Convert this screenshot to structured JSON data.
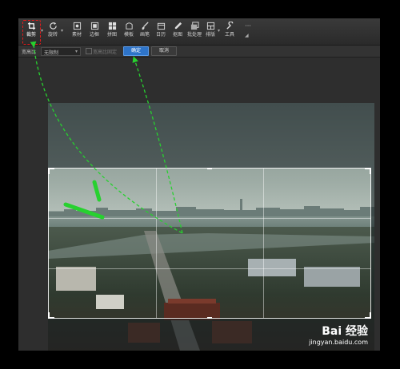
{
  "toolbar": {
    "items": [
      {
        "label": "裁剪",
        "icon": "crop-icon"
      },
      {
        "label": "旋转",
        "icon": "rotate-icon"
      },
      {
        "label": "素材",
        "icon": "material-icon"
      },
      {
        "label": "边框",
        "icon": "border-icon"
      },
      {
        "label": "拼图",
        "icon": "collage-icon"
      },
      {
        "label": "模板",
        "icon": "template-icon"
      },
      {
        "label": "画笔",
        "icon": "brush-icon"
      },
      {
        "label": "日历",
        "icon": "calendar-icon"
      },
      {
        "label": "抠图",
        "icon": "cutout-icon"
      },
      {
        "label": "批处理",
        "icon": "batch-icon"
      },
      {
        "label": "排版",
        "icon": "layout-icon"
      },
      {
        "label": "工具",
        "icon": "tools-icon"
      }
    ],
    "more": "···",
    "active": "裁剪"
  },
  "options": {
    "ratio_label": "宽高比",
    "ratio_value": "无限制",
    "lock_label": "宽高比固定",
    "confirm": "确定",
    "cancel": "取消"
  },
  "watermark": {
    "logo": "Bai 经验",
    "url": "jingyan.baidu.com"
  },
  "colors": {
    "annotation_red": "#e21b1b",
    "annotation_green": "#27d12f",
    "confirm_blue": "#2e74c9"
  }
}
